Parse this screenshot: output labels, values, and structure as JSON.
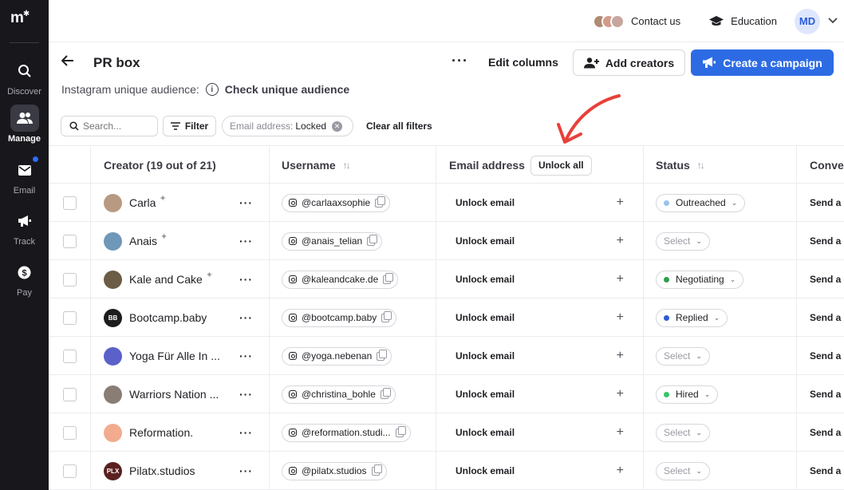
{
  "sidebar": {
    "logo": "m",
    "items": [
      {
        "label": "Discover",
        "icon": "search-icon"
      },
      {
        "label": "Manage",
        "icon": "users-icon",
        "active": true
      },
      {
        "label": "Email",
        "icon": "envelope-icon",
        "notification": true
      },
      {
        "label": "Track",
        "icon": "megaphone-icon"
      },
      {
        "label": "Pay",
        "icon": "dollar-icon"
      }
    ]
  },
  "topbar": {
    "contact_label": "Contact us",
    "education_label": "Education",
    "user_initials": "MD"
  },
  "page": {
    "title": "PR box",
    "edit_columns": "Edit columns",
    "add_creators": "Add creators",
    "create_campaign": "Create a campaign",
    "audience_label": "Instagram unique audience:",
    "audience_link": "Check unique audience"
  },
  "filters": {
    "search_placeholder": "Search...",
    "filter_label": "Filter",
    "chip_key": "Email address:",
    "chip_value": "Locked",
    "clear_label": "Clear all filters"
  },
  "table": {
    "headers": {
      "creator": "Creator (19 out of 21)",
      "username": "Username",
      "email": "Email address",
      "unlock_all": "Unlock all",
      "status": "Status",
      "conversation": "Conve"
    },
    "unlock_label": "Unlock email",
    "send_label": "Send a",
    "rows": [
      {
        "name": "Carla",
        "username": "@carlaaxsophie",
        "status": "Outreached",
        "dot": "#9cc3ee",
        "spark": true,
        "avatar": "#b89a82",
        "avatar_text": ""
      },
      {
        "name": "Anais",
        "username": "@anais_telian",
        "status": "Select",
        "dot": "",
        "spark": true,
        "avatar": "#6f97b8",
        "avatar_text": ""
      },
      {
        "name": "Kale and Cake",
        "username": "@kaleandcake.de",
        "status": "Negotiating",
        "dot": "#2e9e4f",
        "spark": true,
        "avatar": "#6b5c45",
        "avatar_text": ""
      },
      {
        "name": "Bootcamp.baby",
        "username": "@bootcamp.baby",
        "status": "Replied",
        "dot": "#2d5bd7",
        "spark": false,
        "avatar": "#1c1c1c",
        "avatar_text": "BB"
      },
      {
        "name": "Yoga Für Alle In ...",
        "username": "@yoga.nebenan",
        "status": "Select",
        "dot": "",
        "spark": false,
        "avatar": "#5b61c9",
        "avatar_text": ""
      },
      {
        "name": "Warriors Nation ...",
        "username": "@christina_bohle",
        "status": "Hired",
        "dot": "#39c46a",
        "spark": false,
        "avatar": "#8a7d76",
        "avatar_text": ""
      },
      {
        "name": "Reformation.",
        "username": "@reformation.studi...",
        "status": "Select",
        "dot": "",
        "spark": false,
        "avatar": "#f2ab8e",
        "avatar_text": ""
      },
      {
        "name": "Pilatx.studios",
        "username": "@pilatx.studios",
        "status": "Select",
        "dot": "",
        "spark": false,
        "avatar": "#5b2020",
        "avatar_text": "PLX"
      }
    ]
  }
}
